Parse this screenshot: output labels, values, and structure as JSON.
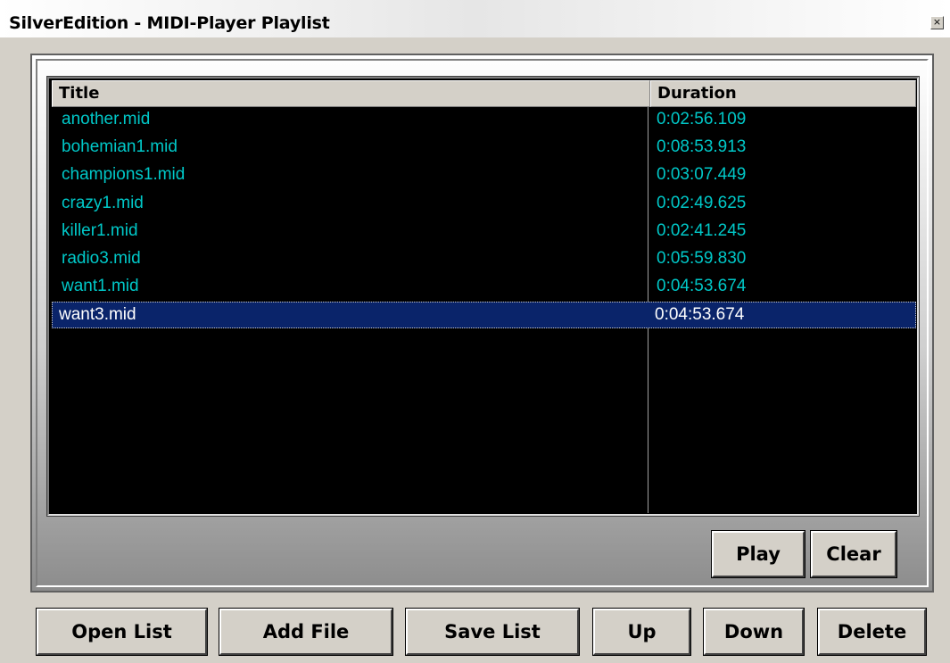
{
  "window": {
    "title": "SilverEdition - MIDI-Player Playlist",
    "close_glyph": "×"
  },
  "playlist": {
    "columns": [
      "Title",
      "Duration"
    ],
    "rows": [
      {
        "title": "another.mid",
        "duration": "0:02:56.109",
        "selected": false
      },
      {
        "title": "bohemian1.mid",
        "duration": "0:08:53.913",
        "selected": false
      },
      {
        "title": "champions1.mid",
        "duration": "0:03:07.449",
        "selected": false
      },
      {
        "title": "crazy1.mid",
        "duration": "0:02:49.625",
        "selected": false
      },
      {
        "title": "killer1.mid",
        "duration": "0:02:41.245",
        "selected": false
      },
      {
        "title": "radio3.mid",
        "duration": "0:05:59.830",
        "selected": false
      },
      {
        "title": "want1.mid",
        "duration": "0:04:53.674",
        "selected": false
      },
      {
        "title": "want3.mid",
        "duration": "0:04:53.674",
        "selected": true
      }
    ]
  },
  "panel_buttons": {
    "play": "Play",
    "clear": "Clear"
  },
  "bottom_buttons": {
    "open_list": "Open List",
    "add_file": "Add File",
    "save_list": "Save List",
    "up": "Up",
    "down": "Down",
    "delete": "Delete"
  },
  "colors": {
    "list_background": "#000000",
    "list_text": "#00c8c8",
    "selection": "#0a246a"
  }
}
